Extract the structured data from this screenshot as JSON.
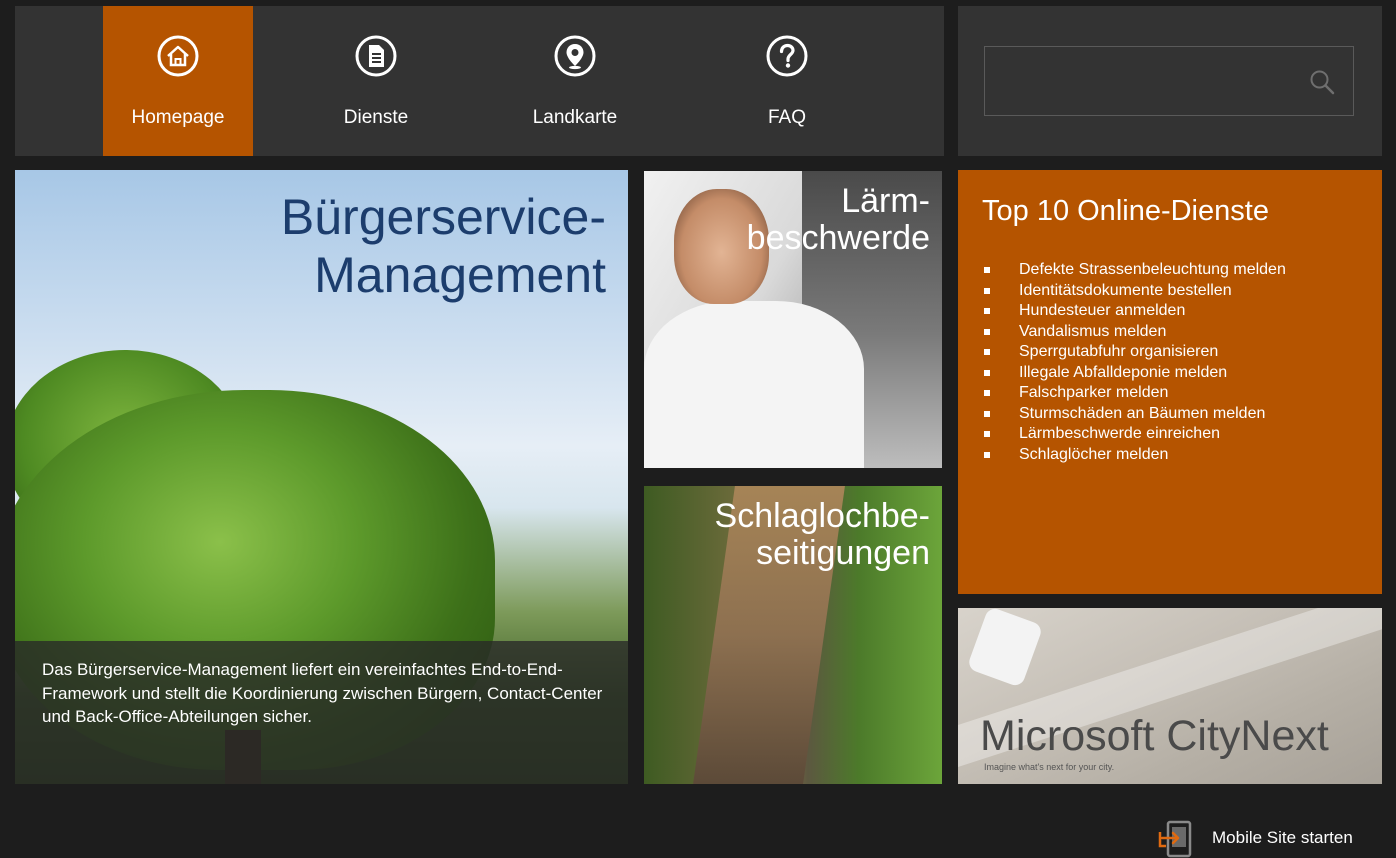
{
  "nav": {
    "items": [
      {
        "label": "Homepage",
        "icon": "home-icon",
        "active": true
      },
      {
        "label": "Dienste",
        "icon": "document-icon",
        "active": false
      },
      {
        "label": "Landkarte",
        "icon": "map-pin-icon",
        "active": false
      },
      {
        "label": "FAQ",
        "icon": "question-icon",
        "active": false
      }
    ]
  },
  "search": {
    "value": "",
    "placeholder": ""
  },
  "hero": {
    "title_line1": "Bürgerservice-",
    "title_line2": "Management",
    "description": "Das Bürgerservice-Management liefert ein vereinfachtes End-to-End-Framework und stellt die Koordinierung zwischen Bürgern, Contact-Center und Back-Office-Abteilungen sicher."
  },
  "tiles": {
    "laerm": {
      "line1": "Lärm-",
      "line2": "beschwerde"
    },
    "schlag": {
      "line1": "Schlaglochbe-",
      "line2": "seitigungen"
    }
  },
  "top10": {
    "title": "Top 10 Online-Dienste",
    "items": [
      "Defekte Strassenbeleuchtung melden",
      "Identitätsdokumente bestellen",
      "Hundesteuer anmelden",
      "Vandalismus melden",
      "Sperrgutabfuhr organisieren",
      "Illegale Abfalldeponie melden",
      "Falschparker melden",
      "Sturmschäden an Bäumen melden",
      "Lärmbeschwerde einreichen",
      "Schlaglöcher melden"
    ]
  },
  "citynext": {
    "title": "Microsoft CityNext",
    "subtitle": "Imagine what's next for your city."
  },
  "mobile": {
    "label": "Mobile Site starten",
    "icon": "mobile-icon"
  },
  "colors": {
    "accent": "#b55400",
    "background": "#1d1d1d",
    "panel": "#333333",
    "hero_title": "#1c3d6d"
  }
}
